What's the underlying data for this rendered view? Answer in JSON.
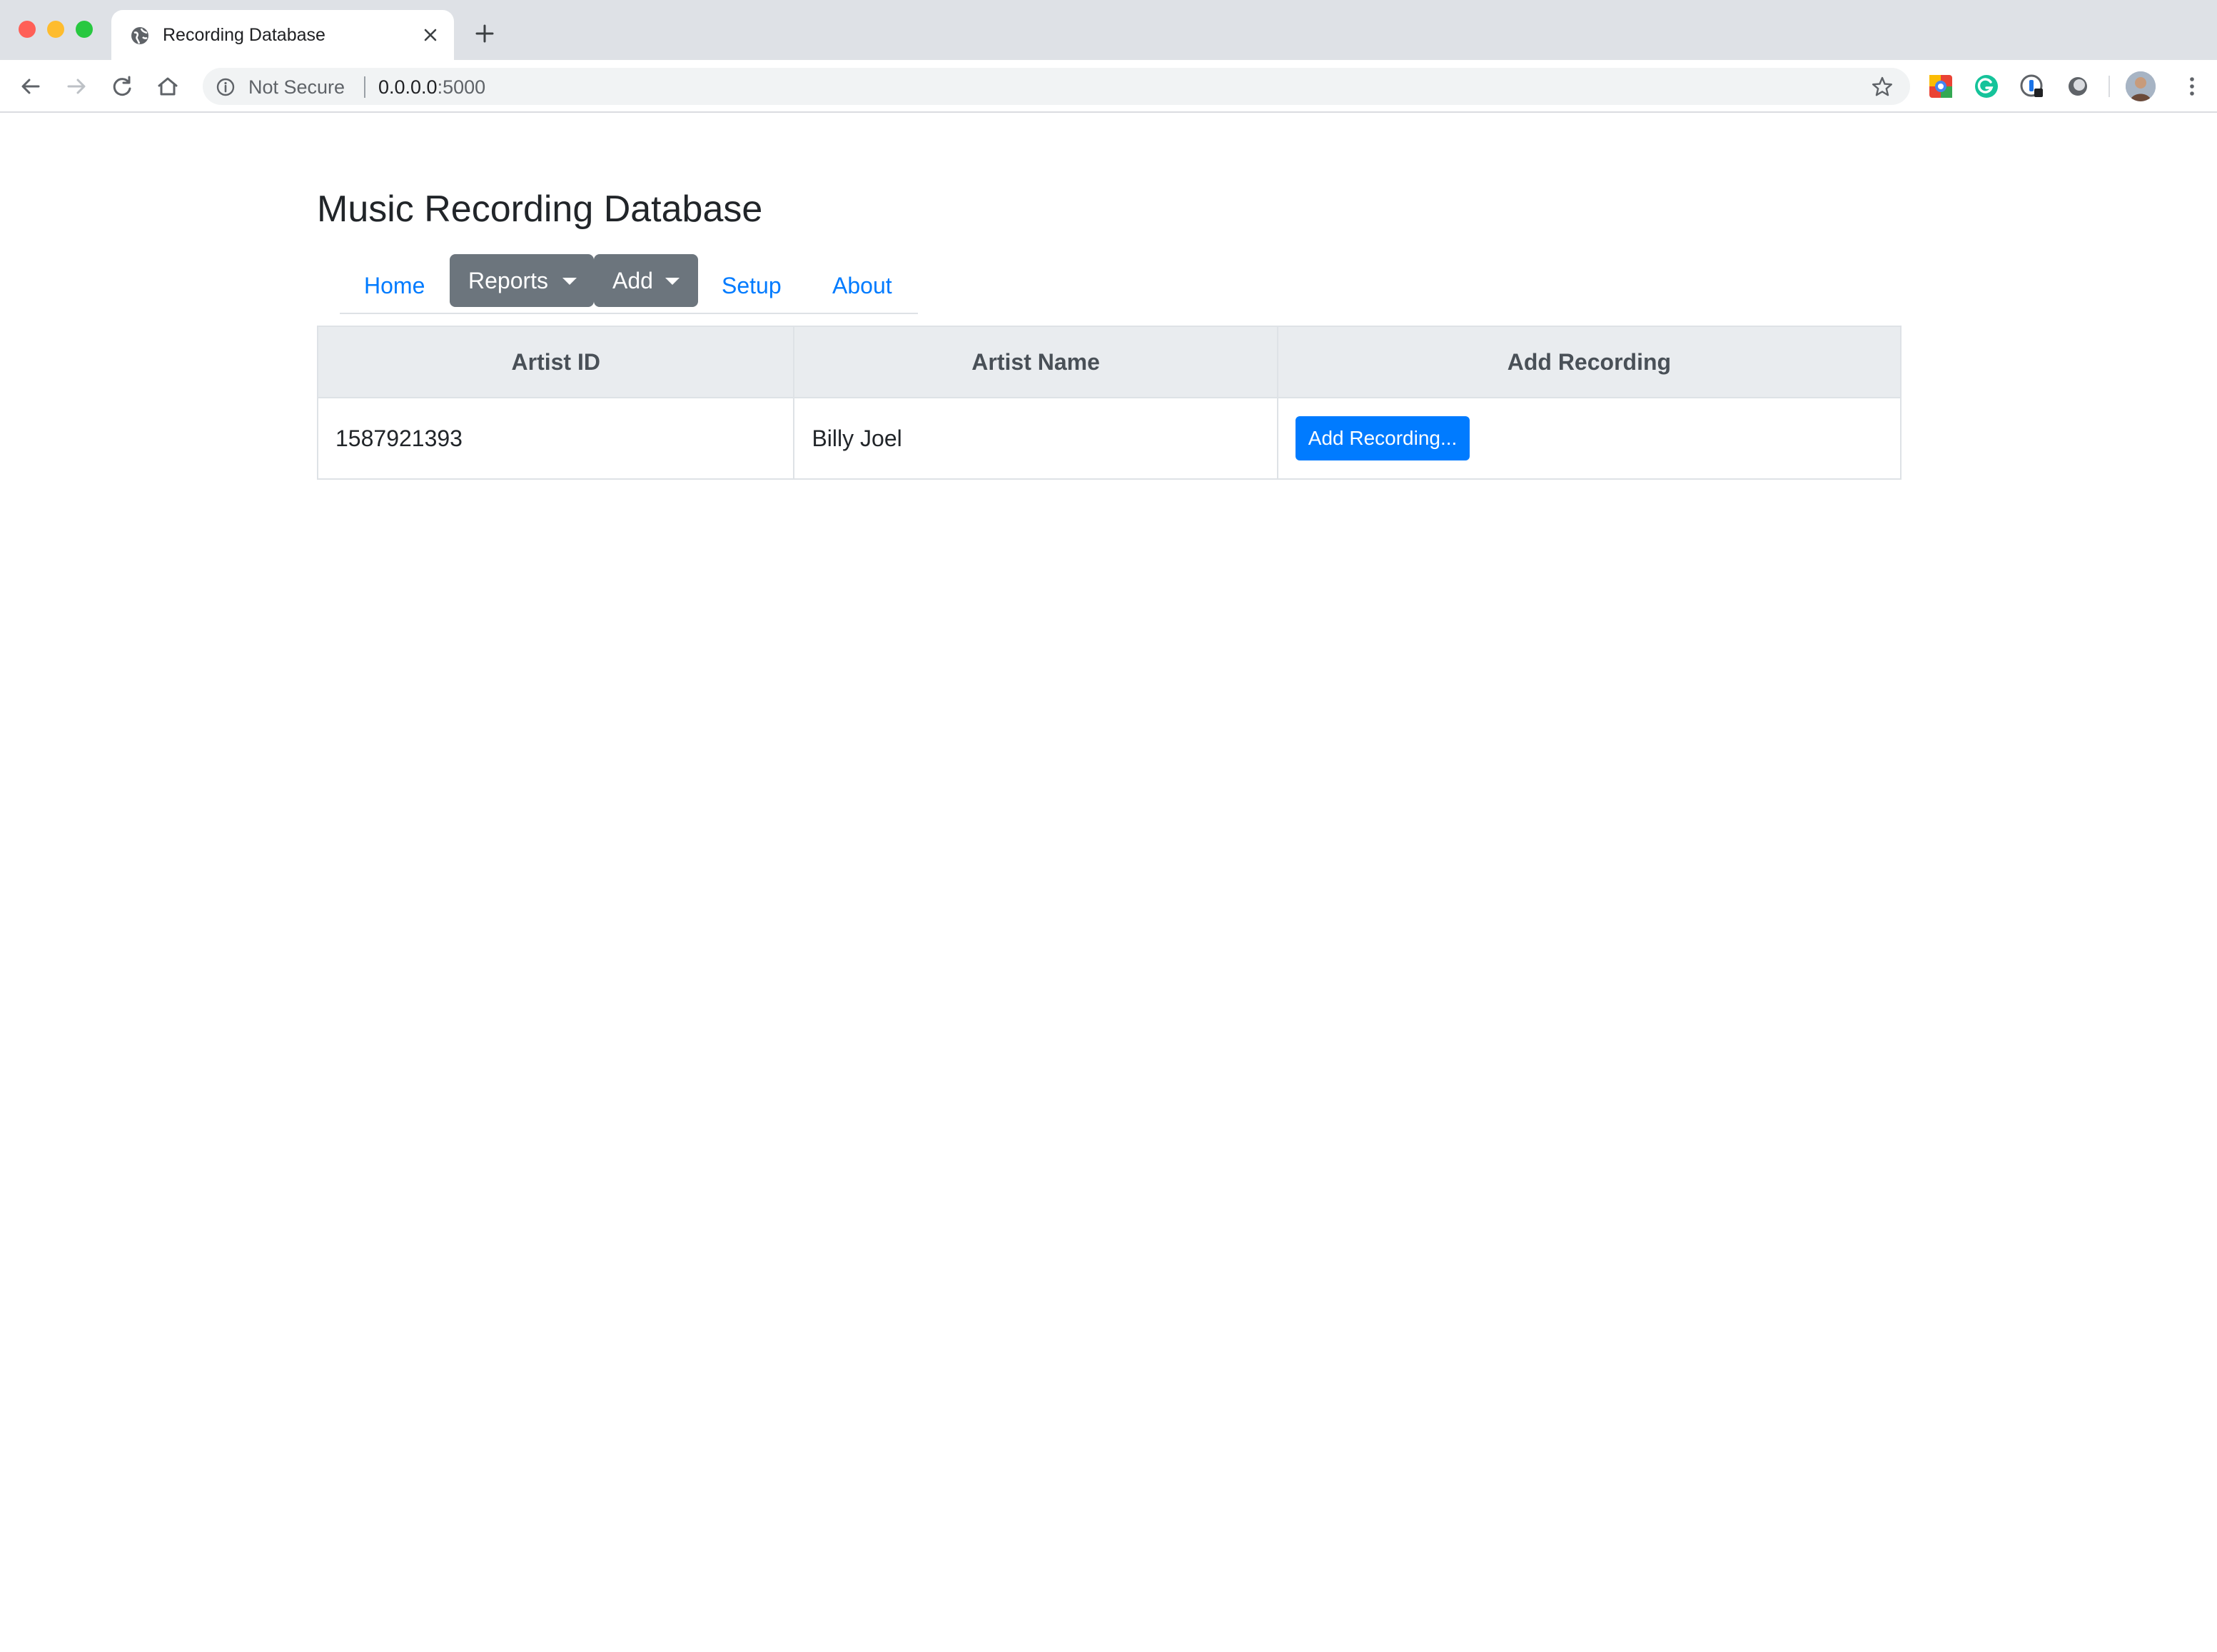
{
  "browser": {
    "tab_title": "Recording Database",
    "omnibox": {
      "security_label": "Not Secure",
      "url_host": "0.0.0.0",
      "url_port": ":5000"
    },
    "icons": [
      "back-icon",
      "forward-icon",
      "reload-icon",
      "home-icon",
      "info-icon",
      "star-icon",
      "menu-icon"
    ]
  },
  "page": {
    "title": "Music Recording Database",
    "nav": {
      "home": "Home",
      "reports": "Reports",
      "add": "Add",
      "setup": "Setup",
      "about": "About"
    },
    "table": {
      "headers": [
        "Artist ID",
        "Artist Name",
        "Add Recording"
      ],
      "rows": [
        {
          "artist_id": "1587921393",
          "artist_name": "Billy Joel",
          "action_label": "Add Recording..."
        }
      ]
    }
  },
  "colors": {
    "link": "#007bff",
    "dropdown_bg": "#6c757d",
    "primary_button": "#007bff",
    "table_header_bg": "#e9ecef"
  }
}
